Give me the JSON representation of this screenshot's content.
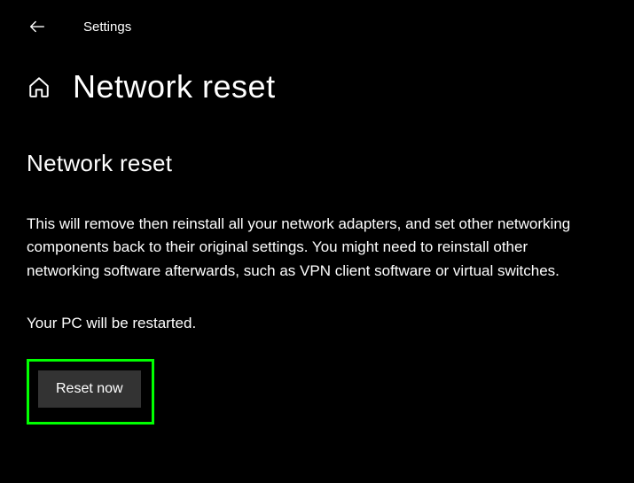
{
  "header": {
    "app_title": "Settings"
  },
  "page": {
    "title": "Network reset",
    "section_heading": "Network reset",
    "description": "This will remove then reinstall all your network adapters, and set other networking components back to their original settings. You might need to reinstall other networking software afterwards, such as VPN client software or virtual switches.",
    "restart_note": "Your PC will be restarted.",
    "reset_button_label": "Reset now"
  },
  "colors": {
    "highlight": "#00ff00",
    "button_bg": "#333333"
  }
}
